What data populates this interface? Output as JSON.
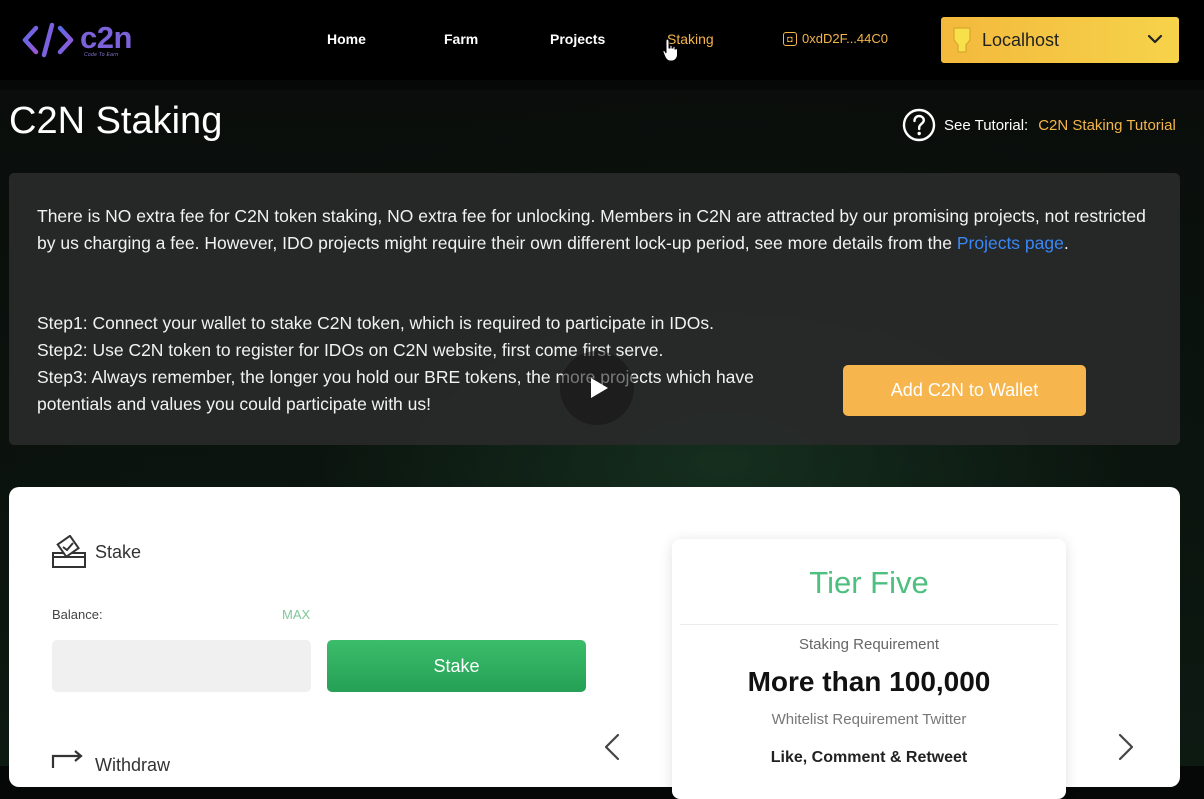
{
  "nav": {
    "logo_text": "c2n",
    "logo_subtitle": "Code To Earn",
    "links": [
      {
        "label": "Home"
      },
      {
        "label": "Farm"
      },
      {
        "label": "Projects"
      },
      {
        "label": "Staking",
        "active": true
      }
    ],
    "wallet_address": "0xdD2F...44C0",
    "network_label": "Localhost",
    "accent_color": "#f5b54a"
  },
  "header": {
    "title": "C2N Staking",
    "tutorial_label": "See Tutorial:",
    "tutorial_link": "C2N Staking Tutorial"
  },
  "info": {
    "text_before_link": "There is NO extra fee for C2N token staking, NO extra fee for unlocking. Members in C2N are attracted by our promising projects, not restricted by us charging a fee. However, IDO projects might require their own different lock-up period, see more details from the ",
    "link_text": "Projects page",
    "text_after_link": ".",
    "steps": [
      "Step1: Connect your wallet to stake C2N token, which is required to participate in IDOs.",
      "Step2: Use C2N token to register for IDOs on C2N website, first come first serve.",
      "Step3: Always remember, the longer you hold our BRE tokens, the more projects which have potentials and values you could participate with us!"
    ],
    "add_wallet_button": "Add C2N to Wallet"
  },
  "stake": {
    "heading": "Stake",
    "balance_label": "Balance:",
    "max_label": "MAX",
    "input_value": "",
    "button_label": "Stake",
    "withdraw_heading": "Withdraw"
  },
  "tier": {
    "title": "Tier Five",
    "requirement_label": "Staking Requirement",
    "requirement_value": "More than 100,000",
    "whitelist_label": "Whitelist Requirement Twitter",
    "whitelist_value": "Like, Comment & Retweet"
  }
}
